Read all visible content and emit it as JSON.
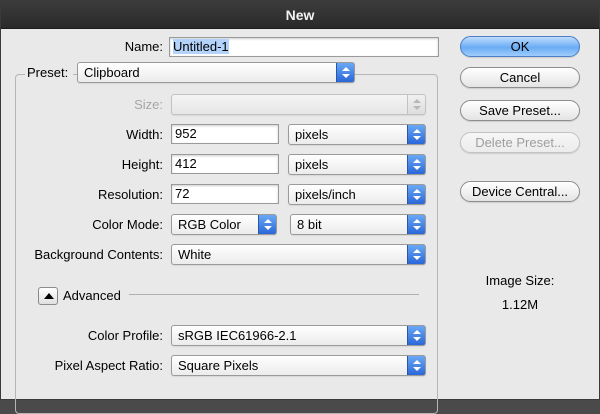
{
  "window": {
    "title": "New"
  },
  "form": {
    "name_label": "Name:",
    "name_value": "Untitled-1",
    "preset_label": "Preset:",
    "preset_value": "Clipboard",
    "size_label": "Size:",
    "size_value": "",
    "width_label": "Width:",
    "width_value": "952",
    "width_unit": "pixels",
    "height_label": "Height:",
    "height_value": "412",
    "height_unit": "pixels",
    "resolution_label": "Resolution:",
    "resolution_value": "72",
    "resolution_unit": "pixels/inch",
    "color_mode_label": "Color Mode:",
    "color_mode_value": "RGB Color",
    "bit_depth_value": "8 bit",
    "background_label": "Background Contents:",
    "background_value": "White",
    "advanced_label": "Advanced",
    "color_profile_label": "Color Profile:",
    "color_profile_value": "sRGB IEC61966-2.1",
    "pixel_aspect_label": "Pixel Aspect Ratio:",
    "pixel_aspect_value": "Square Pixels"
  },
  "buttons": {
    "ok": "OK",
    "cancel": "Cancel",
    "save_preset": "Save Preset...",
    "delete_preset": "Delete Preset...",
    "device_central": "Device Central..."
  },
  "image_size": {
    "label": "Image Size:",
    "value": "1.12M"
  },
  "colors": {
    "accent": "#3d7ee0",
    "default_button": "#8ec2fb",
    "titlebar": "#333333"
  },
  "icons": {
    "popup_arrows": "up-down-arrows-icon",
    "advanced_toggle": "disclosure-triangle-icon"
  }
}
